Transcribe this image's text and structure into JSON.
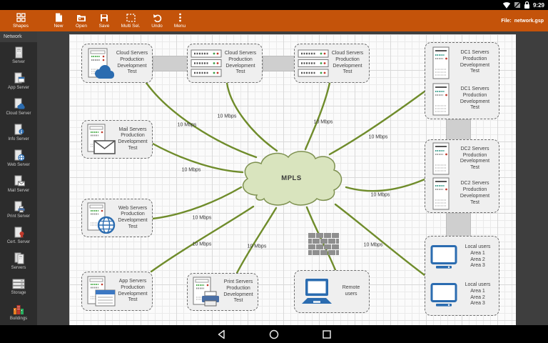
{
  "status_bar": {
    "time": "9:29"
  },
  "toolbar": {
    "buttons": [
      "Shapes",
      "New",
      "Open",
      "Save",
      "Multi Sel.",
      "Undo",
      "Menu"
    ],
    "file_label": "File:",
    "file_name": "network.gsp"
  },
  "sidebar": {
    "header": "Network",
    "items": [
      "Server",
      "App Server",
      "Cloud Server",
      "Info Server",
      "Web Server",
      "Mail Server",
      "Print Server",
      "Cert. Server",
      "Servers",
      "Storage",
      "Buildings"
    ]
  },
  "canvas": {
    "mpls_label": "MPLS",
    "link_label": "10 Mbps",
    "nodes": {
      "cloud_servers": "Cloud Servers\nProduction\nDevelopment\nTest",
      "dc1_servers": "DC1 Servers\nProduction\nDevelopment\nTest",
      "dc2_servers": "DC2 Servers\nProduction\nDevelopment\nTest",
      "mail_servers": "Mail Servers\nProduction\nDevelopment\nTest",
      "web_servers": "Web Servers\nProduction\nDevelopment\nTest",
      "app_servers": "App Servers\nProduction\nDevelopment\nTest",
      "print_servers": "Print Servers\nProduction\nDevelopment\nTest",
      "remote_users": "Remote users",
      "local_users": "Local users\nArea 1\nArea 2\nArea 3"
    }
  },
  "colors": {
    "toolbar_orange": "#C4530A",
    "link_green": "#6F8C2B",
    "cloud_fill": "#D9E4BE",
    "icon_blue": "#2B6CB0"
  }
}
